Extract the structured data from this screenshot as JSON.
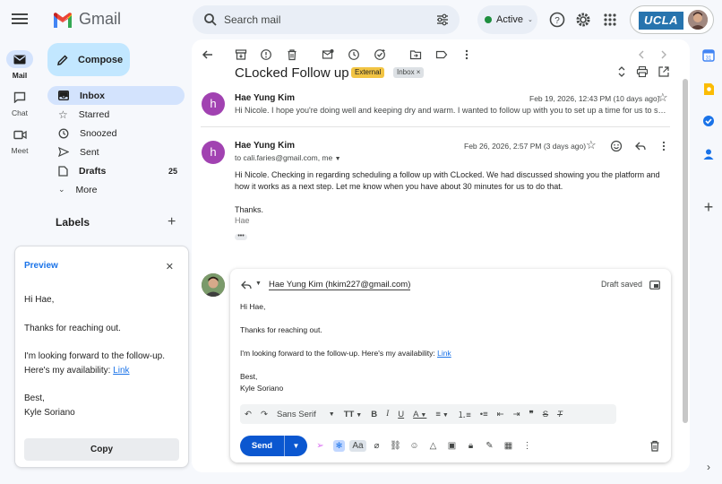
{
  "app": {
    "name": "Gmail"
  },
  "search": {
    "placeholder": "Search mail"
  },
  "status": {
    "label": "Active"
  },
  "account": {
    "org": "UCLA"
  },
  "rail": [
    {
      "label": "Mail"
    },
    {
      "label": "Chat"
    },
    {
      "label": "Meet"
    }
  ],
  "compose": {
    "label": "Compose"
  },
  "nav": [
    {
      "label": "Inbox",
      "count": ""
    },
    {
      "label": "Starred",
      "count": ""
    },
    {
      "label": "Snoozed",
      "count": ""
    },
    {
      "label": "Sent",
      "count": ""
    },
    {
      "label": "Drafts",
      "count": "25"
    },
    {
      "label": "More",
      "count": ""
    }
  ],
  "labels": {
    "heading": "Labels"
  },
  "preview": {
    "title": "Preview",
    "greeting": "Hi Hae,",
    "line1": "Thanks for reaching out.",
    "line2": "I'm looking forward to the follow-up. Here's my availability: ",
    "link": "Link",
    "signoff": "Best,",
    "name": "Kyle Soriano",
    "copy_label": "Copy"
  },
  "thread": {
    "subject": "CLocked Follow up",
    "badges": [
      "External",
      "Inbox ×"
    ],
    "messages": [
      {
        "avatar": "h",
        "sender": "Hae Yung Kim",
        "date": "Feb 19, 2026, 12:43 PM (10 days ago)",
        "snippet": "Hi Nicole. I hope you're doing well and keeping dry and warm. I wanted to follow up with you to set up a time for us to show you the platform and how it works."
      },
      {
        "avatar": "h",
        "sender": "Hae Yung Kim",
        "date": "Feb 26, 2026, 2:57 PM (3 days ago)",
        "to": "to cali.faries@gmail.com, me",
        "body": "Hi Nicole.  Checking in regarding scheduling a follow up with CLocked. We had discussed showing you the platform and how it works as a next step.  Let me know when you have about 30 minutes for us to do that.",
        "thanks": "Thanks.",
        "sig": "Hae"
      }
    ]
  },
  "draft": {
    "to": "Hae Yung Kim (hkim227@gmail.com)",
    "saved": "Draft saved",
    "greeting": "Hi Hae,",
    "line1": "Thanks for reaching out.",
    "line2": "I'm looking forward to the follow-up. Here's my availability: ",
    "link": "Link",
    "signoff": "Best,",
    "name": "Kyle Soriano",
    "font": "Sans Serif",
    "send_label": "Send"
  }
}
